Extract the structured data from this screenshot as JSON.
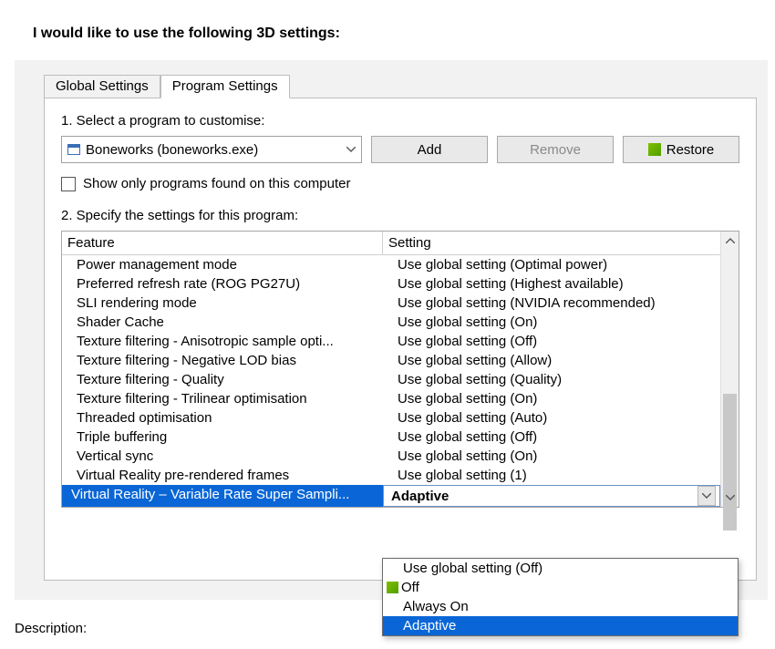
{
  "heading": "I would like to use the following 3D settings:",
  "tabs": {
    "global": "Global Settings",
    "program": "Program Settings"
  },
  "step1_label": "1. Select a program to customise:",
  "program_selected": "Boneworks (boneworks.exe)",
  "buttons": {
    "add": "Add",
    "remove": "Remove",
    "restore": "Restore"
  },
  "show_only_label": "Show only programs found on this computer",
  "step2_label": "2. Specify the settings for this program:",
  "columns": {
    "feature": "Feature",
    "setting": "Setting"
  },
  "rows": [
    {
      "feature": "Power management mode",
      "setting": "Use global setting (Optimal power)"
    },
    {
      "feature": "Preferred refresh rate (ROG PG27U)",
      "setting": "Use global setting (Highest available)"
    },
    {
      "feature": "SLI rendering mode",
      "setting": "Use global setting (NVIDIA recommended)"
    },
    {
      "feature": "Shader Cache",
      "setting": "Use global setting (On)"
    },
    {
      "feature": "Texture filtering - Anisotropic sample opti...",
      "setting": "Use global setting (Off)"
    },
    {
      "feature": "Texture filtering - Negative LOD bias",
      "setting": "Use global setting (Allow)"
    },
    {
      "feature": "Texture filtering - Quality",
      "setting": "Use global setting (Quality)"
    },
    {
      "feature": "Texture filtering - Trilinear optimisation",
      "setting": "Use global setting (On)"
    },
    {
      "feature": "Threaded optimisation",
      "setting": "Use global setting (Auto)"
    },
    {
      "feature": "Triple buffering",
      "setting": "Use global setting (Off)"
    },
    {
      "feature": "Vertical sync",
      "setting": "Use global setting (On)"
    },
    {
      "feature": "Virtual Reality pre-rendered frames",
      "setting": "Use global setting (1)"
    }
  ],
  "selected_row": {
    "feature": "Virtual Reality – Variable Rate Super Sampli...",
    "setting": "Adaptive"
  },
  "dropdown": {
    "opt0": "Use global setting (Off)",
    "opt1": "Off",
    "opt2": "Always On",
    "opt3": "Adaptive"
  },
  "description_label": "Description:"
}
